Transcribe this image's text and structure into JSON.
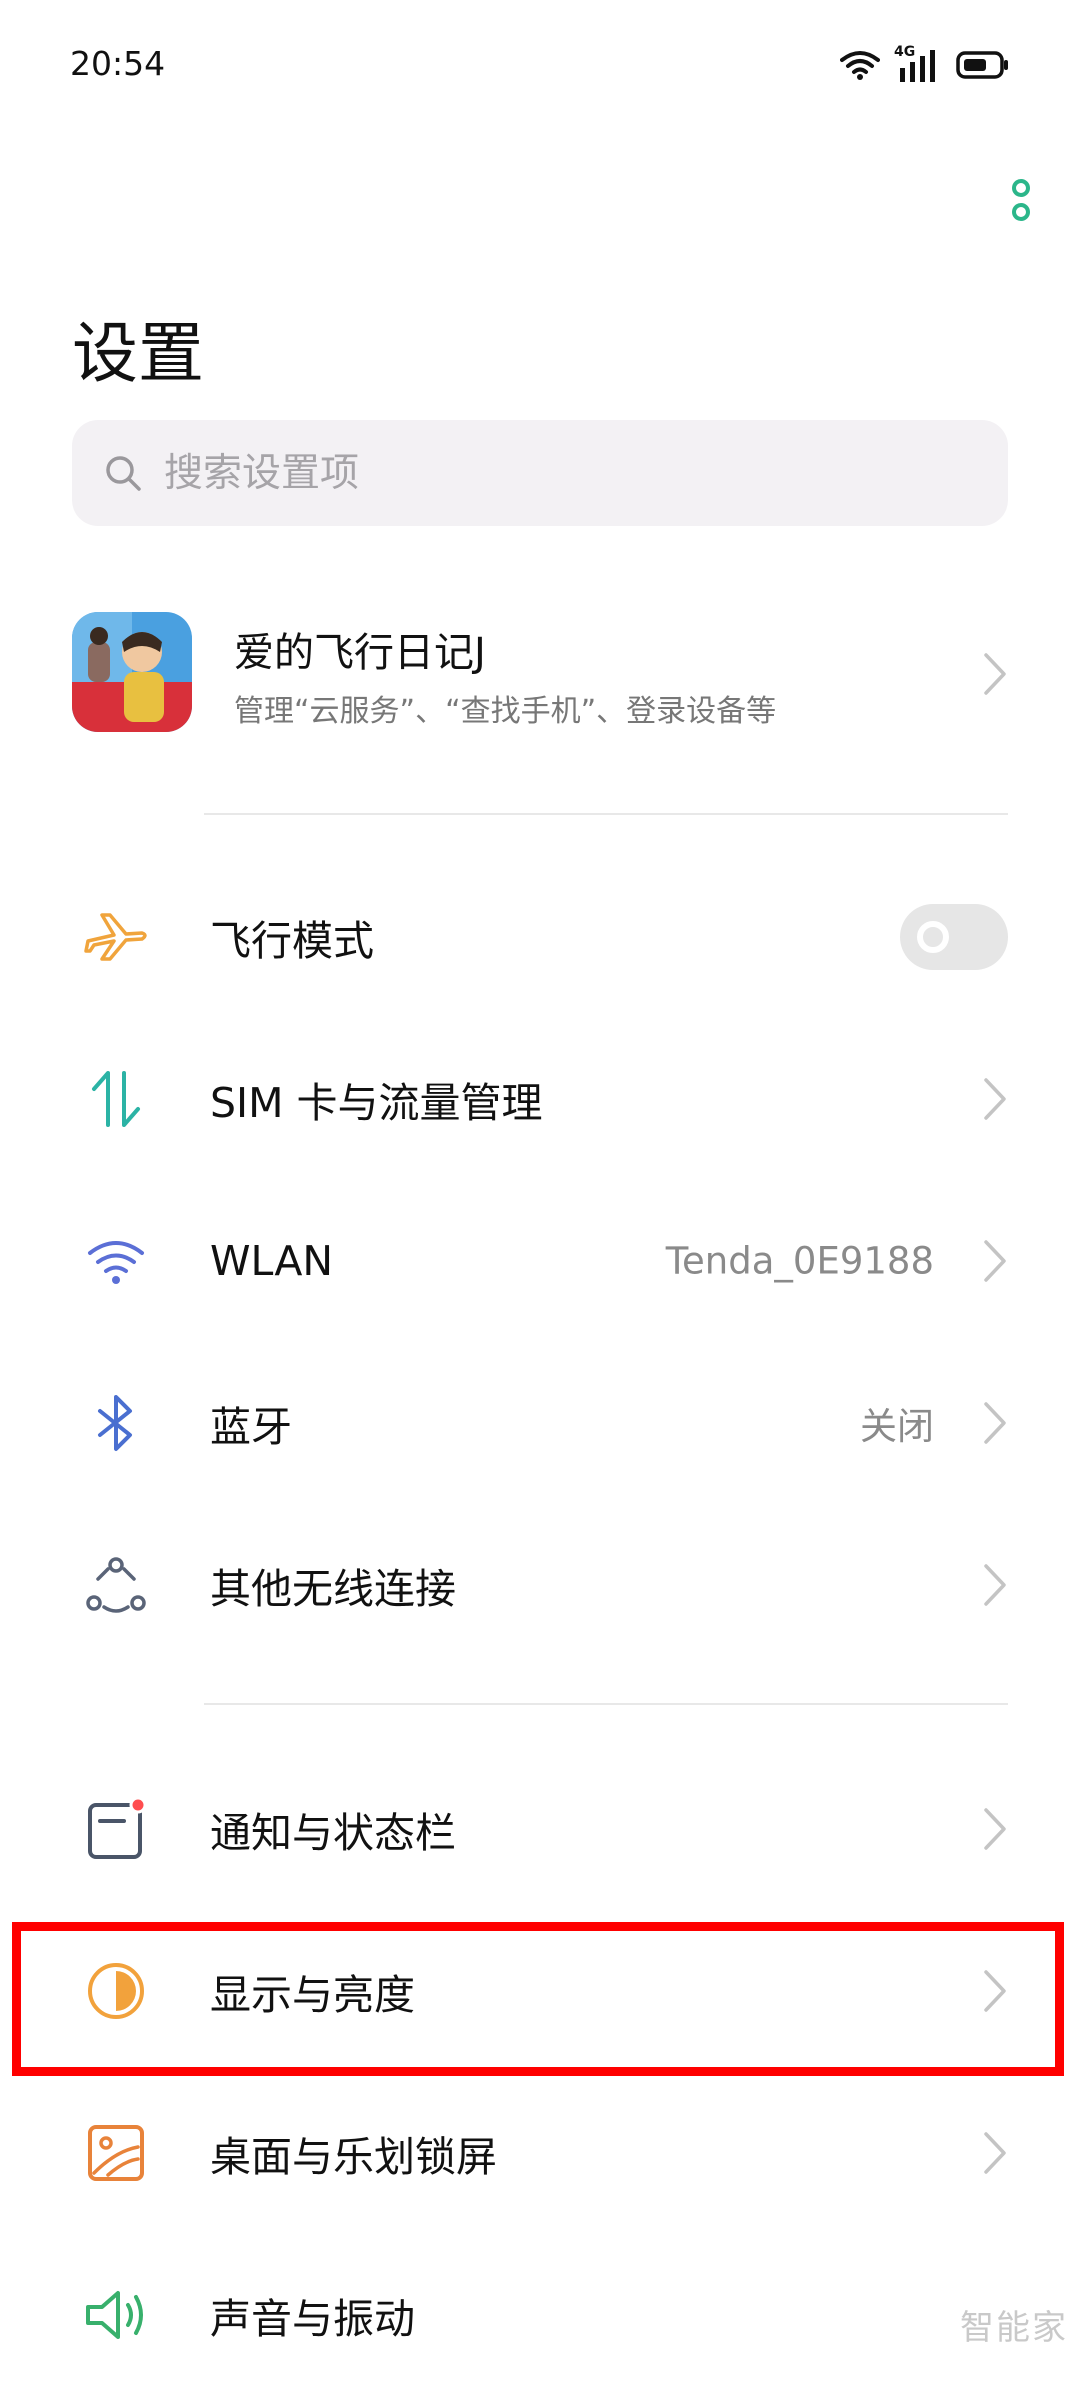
{
  "status_bar": {
    "time": "20:54",
    "network": "4G"
  },
  "page": {
    "title": "设置"
  },
  "search": {
    "placeholder": "搜索设置项"
  },
  "account": {
    "name": "爱的飞行日记J",
    "subtitle": "管理“云服务”、“查找手机”、登录设备等"
  },
  "items": [
    {
      "label": "飞行模式",
      "icon": "airplane-icon",
      "control": "toggle",
      "toggle_on": false
    },
    {
      "label": "SIM 卡与流量管理",
      "icon": "data-transfer-icon"
    },
    {
      "label": "WLAN",
      "value": "Tenda_0E9188",
      "icon": "wifi-icon"
    },
    {
      "label": "蓝牙",
      "value": "关闭",
      "icon": "bluetooth-icon"
    },
    {
      "label": "其他无线连接",
      "icon": "wireless-connections-icon"
    },
    {
      "label": "通知与状态栏",
      "icon": "notification-icon"
    },
    {
      "label": "显示与亮度",
      "icon": "display-brightness-icon",
      "highlighted": true
    },
    {
      "label": "桌面与乐划锁屏",
      "icon": "wallpaper-icon"
    },
    {
      "label": "声音与振动",
      "icon": "sound-icon"
    }
  ],
  "watermark": "智能家",
  "colors": {
    "accent": "#2bb68a",
    "highlight": "#ff0000",
    "airplane": "#f0a43c",
    "sim": "#2bb3a5",
    "wifi": "#5b6fd6",
    "bluetooth": "#4a6fd0",
    "notification": "#4a5568",
    "notification_dot": "#ff4d4f",
    "display": "#f2a23c",
    "wallpaper": "#e8833a",
    "sound": "#38b06c"
  }
}
